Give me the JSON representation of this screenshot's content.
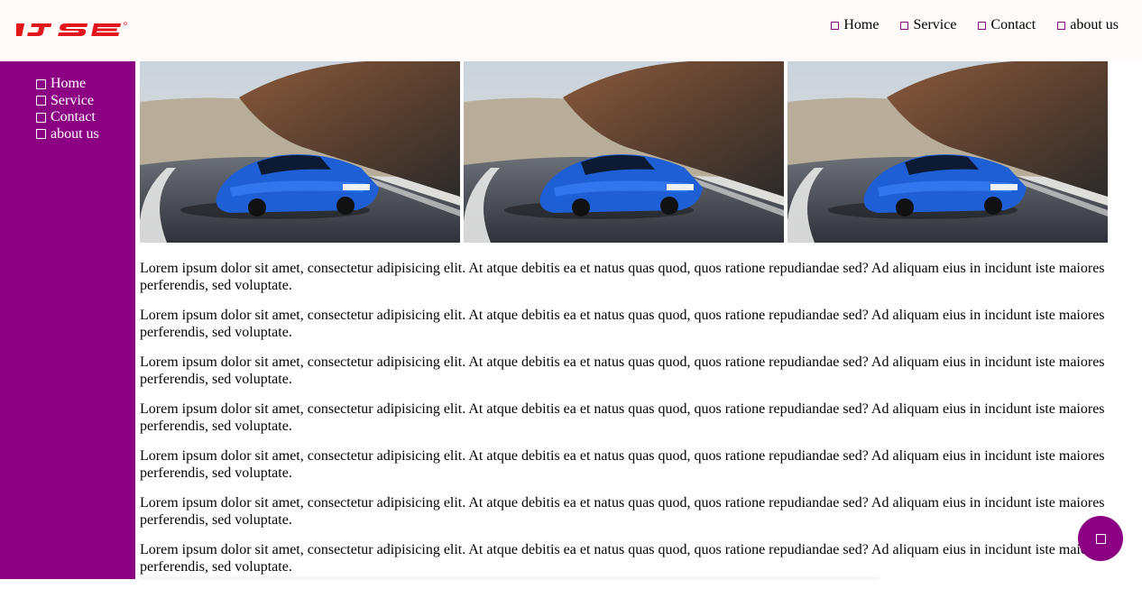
{
  "brand": {
    "name": "IJSE",
    "color": "#e3161b"
  },
  "colors": {
    "accent": "#8b0083",
    "header_bg": "#fefaf9"
  },
  "top_nav": {
    "items": [
      {
        "label": "Home",
        "icon": "square-icon"
      },
      {
        "label": "Service",
        "icon": "square-icon"
      },
      {
        "label": "Contact",
        "icon": "square-icon"
      },
      {
        "label": "about us",
        "icon": "square-icon"
      }
    ]
  },
  "side_nav": {
    "items": [
      {
        "label": "Home",
        "icon": "square-icon"
      },
      {
        "label": "Service",
        "icon": "square-icon"
      },
      {
        "label": "Contact",
        "icon": "square-icon"
      },
      {
        "label": "about us",
        "icon": "square-icon"
      }
    ]
  },
  "gallery": {
    "images": [
      {
        "plate": "RI21 MCL"
      },
      {
        "plate": "RI21 MCL"
      },
      {
        "plate": "RI21 MCL"
      }
    ]
  },
  "content": {
    "paragraphs": [
      "Lorem ipsum dolor sit amet, consectetur adipisicing elit. At atque debitis ea et natus quas quod, quos ratione repudiandae sed? Ad aliquam eius in incidunt iste maiores perferendis, sed voluptate.",
      "Lorem ipsum dolor sit amet, consectetur adipisicing elit. At atque debitis ea et natus quas quod, quos ratione repudiandae sed? Ad aliquam eius in incidunt iste maiores perferendis, sed voluptate.",
      "Lorem ipsum dolor sit amet, consectetur adipisicing elit. At atque debitis ea et natus quas quod, quos ratione repudiandae sed? Ad aliquam eius in incidunt iste maiores perferendis, sed voluptate.",
      "Lorem ipsum dolor sit amet, consectetur adipisicing elit. At atque debitis ea et natus quas quod, quos ratione repudiandae sed? Ad aliquam eius in incidunt iste maiores perferendis, sed voluptate.",
      "Lorem ipsum dolor sit amet, consectetur adipisicing elit. At atque debitis ea et natus quas quod, quos ratione repudiandae sed? Ad aliquam eius in incidunt iste maiores perferendis, sed voluptate.",
      "Lorem ipsum dolor sit amet, consectetur adipisicing elit. At atque debitis ea et natus quas quod, quos ratione repudiandae sed? Ad aliquam eius in incidunt iste maiores perferendis, sed voluptate.",
      "Lorem ipsum dolor sit amet, consectetur adipisicing elit. At atque debitis ea et natus quas quod, quos ratione repudiandae sed? Ad aliquam eius in incidunt iste maiores perferendis, sed voluptate."
    ]
  },
  "fab": {
    "icon": "square-icon"
  }
}
